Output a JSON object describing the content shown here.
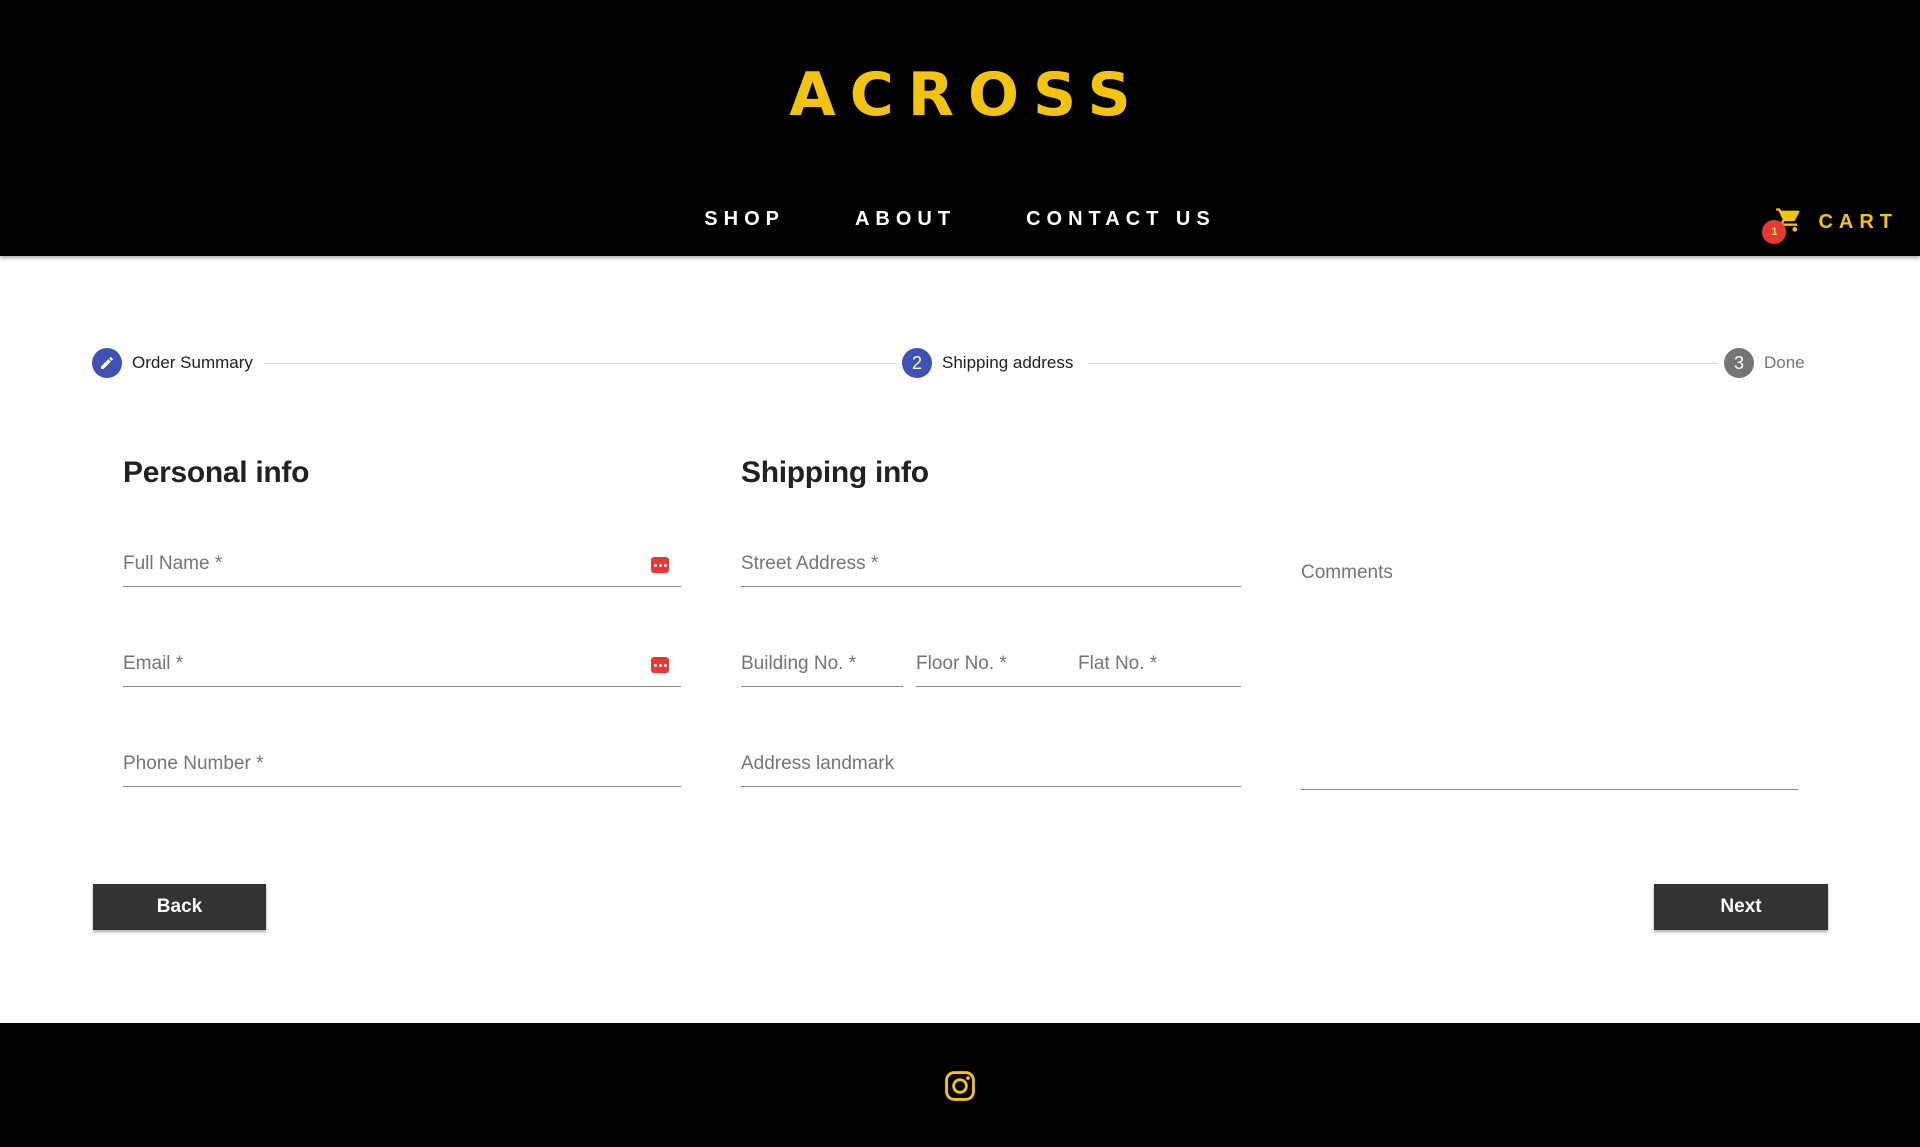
{
  "brand": {
    "logo_text": "ACROSS",
    "accent_color": "#f2c40f"
  },
  "nav": {
    "items": [
      {
        "label": "SHOP"
      },
      {
        "label": "ABOUT"
      },
      {
        "label": "CONTACT US"
      }
    ],
    "cart": {
      "label": "CART",
      "count": "1",
      "icon": "cart-icon"
    }
  },
  "stepper": {
    "steps": [
      {
        "label": "Order Summary",
        "marker": "edit-icon",
        "state": "completed"
      },
      {
        "label": "Shipping address",
        "marker": "2",
        "state": "current"
      },
      {
        "label": "Done",
        "marker": "3",
        "state": "pending"
      }
    ],
    "active_color": "#3f51b5"
  },
  "personal": {
    "title": "Personal info",
    "full_name": {
      "placeholder": "Full Name *",
      "value": ""
    },
    "email": {
      "placeholder": "Email *",
      "value": ""
    },
    "phone": {
      "placeholder": "Phone Number *",
      "value": ""
    }
  },
  "shipping": {
    "title": "Shipping info",
    "street": {
      "placeholder": "Street Address *",
      "value": ""
    },
    "building": {
      "placeholder": "Building No. *",
      "value": ""
    },
    "floor": {
      "placeholder": "Floor No. *",
      "value": ""
    },
    "flat": {
      "placeholder": "Flat No. *",
      "value": ""
    },
    "landmark": {
      "placeholder": "Address landmark",
      "value": ""
    },
    "comments": {
      "placeholder": "Comments",
      "value": ""
    }
  },
  "actions": {
    "back_label": "Back",
    "next_label": "Next"
  },
  "footer": {
    "icon": "instagram-icon"
  }
}
